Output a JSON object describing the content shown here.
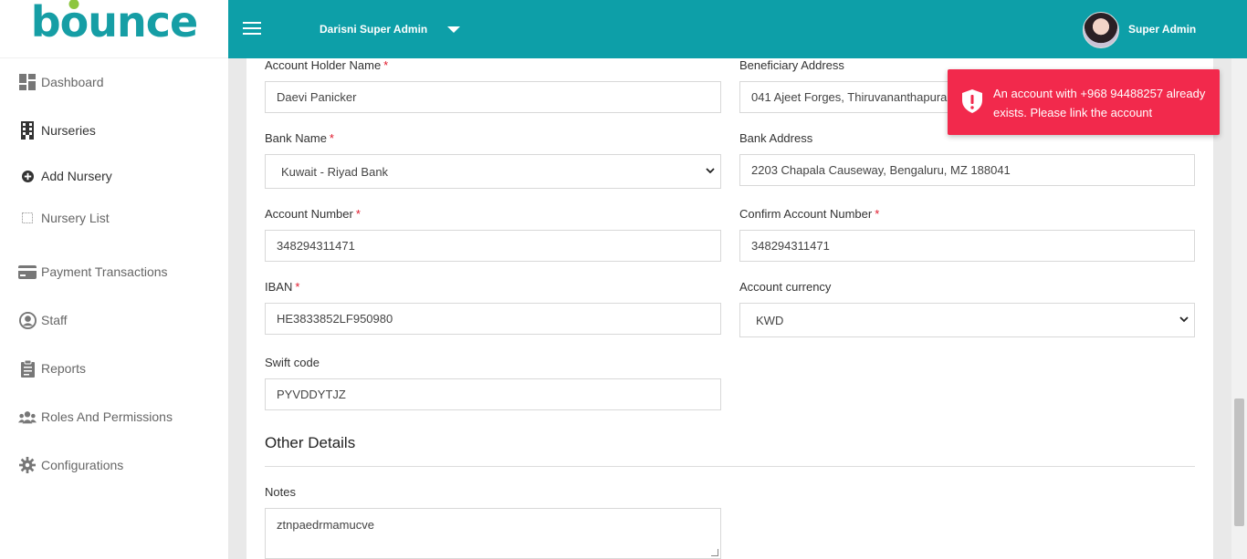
{
  "app": {
    "logo_text": "bounce"
  },
  "header": {
    "tenant_name": "Darisni Super Admin",
    "user_name": "Super Admin"
  },
  "sidebar": {
    "items": [
      {
        "label": "Dashboard",
        "icon": "dashboard-icon"
      },
      {
        "label": "Nurseries",
        "icon": "building-icon"
      },
      {
        "label": "Add Nursery",
        "icon": "plus-circle-icon"
      },
      {
        "label": "Nursery List",
        "icon": "square-icon"
      },
      {
        "label": "Payment Transactions",
        "icon": "credit-card-icon"
      },
      {
        "label": "Staff",
        "icon": "user-circle-icon"
      },
      {
        "label": "Reports",
        "icon": "clipboard-icon"
      },
      {
        "label": "Roles And Permissions",
        "icon": "users-icon"
      },
      {
        "label": "Configurations",
        "icon": "gear-icon"
      }
    ]
  },
  "form": {
    "account_holder_label": "Account Holder Name",
    "account_holder_value": "Daevi Panicker",
    "beneficiary_address_label": "Beneficiary Address",
    "beneficiary_address_value": "041 Ajeet Forges, Thiruvananthapuram",
    "bank_name_label": "Bank Name",
    "bank_name_value": "Kuwait - Riyad Bank",
    "bank_address_label": "Bank Address",
    "bank_address_value": "2203 Chapala Causeway, Bengaluru, MZ 188041",
    "account_number_label": "Account Number",
    "account_number_value": "348294311471",
    "confirm_account_label": "Confirm Account Number",
    "confirm_account_value": "348294311471",
    "iban_label": "IBAN",
    "iban_value": "HE3833852LF950980",
    "currency_label": "Account currency",
    "currency_value": "KWD",
    "swift_label": "Swift code",
    "swift_value": "PYVDDYTJZ",
    "required_mark": "*"
  },
  "other_details": {
    "title": "Other Details",
    "notes_label": "Notes",
    "notes_value": "ztnpaedrmamucve"
  },
  "toast": {
    "message": "An account with +968 94488257 already exists. Please link the account",
    "color": "#f2294c"
  },
  "colors": {
    "header": "#0d9fa8",
    "accent_green": "#8dc63f"
  }
}
